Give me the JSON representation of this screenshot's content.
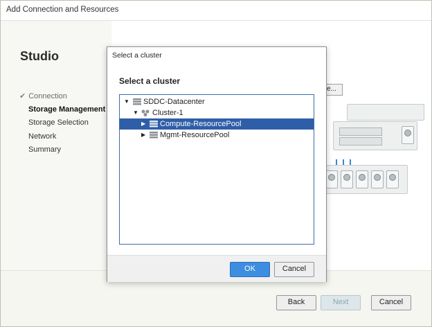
{
  "window": {
    "title": "Add Connection and Resources"
  },
  "sidebar": {
    "app_title": "Studio",
    "items": [
      {
        "label": "Connection",
        "state": "done"
      },
      {
        "label": "Storage Management",
        "state": "current"
      },
      {
        "label": "Storage Selection",
        "state": "pending"
      },
      {
        "label": "Network",
        "state": "pending"
      },
      {
        "label": "Summary",
        "state": "pending"
      }
    ]
  },
  "content": {
    "browse_label": "e..."
  },
  "footer": {
    "back_label": "Back",
    "next_label": "Next",
    "cancel_label": "Cancel"
  },
  "dialog": {
    "title": "Select a cluster",
    "heading": "Select a cluster",
    "tree": [
      {
        "label": "SDDC-Datacenter",
        "level": 0,
        "expanded": true,
        "icon": "datacenter-icon",
        "selected": false
      },
      {
        "label": "Cluster-1",
        "level": 1,
        "expanded": true,
        "icon": "cluster-icon",
        "selected": false
      },
      {
        "label": "Compute-ResourcePool",
        "level": 2,
        "expanded": false,
        "icon": "resource-pool-icon",
        "selected": true
      },
      {
        "label": "Mgmt-ResourcePool",
        "level": 2,
        "expanded": false,
        "icon": "resource-pool-icon",
        "selected": false
      }
    ],
    "ok_label": "OK",
    "cancel_label": "Cancel"
  },
  "colors": {
    "selection": "#2f5ea8",
    "ok_button": "#3d8de0",
    "accent_blue": "#3a86d1"
  }
}
